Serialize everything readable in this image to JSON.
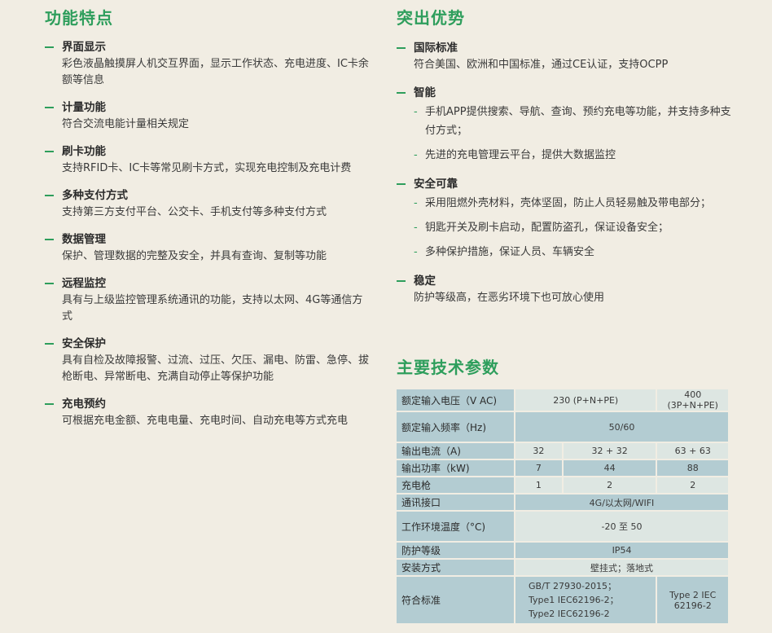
{
  "features": {
    "title": "功能特点",
    "items": [
      {
        "title": "界面显示",
        "desc": "彩色液晶触摸屏人机交互界面，显示工作状态、充电进度、IC卡余额等信息"
      },
      {
        "title": "计量功能",
        "desc": "符合交流电能计量相关规定"
      },
      {
        "title": "刷卡功能",
        "desc": "支持RFID卡、IC卡等常见刷卡方式，实现充电控制及充电计费"
      },
      {
        "title": "多种支付方式",
        "desc": "支持第三方支付平台、公交卡、手机支付等多种支付方式"
      },
      {
        "title": "数据管理",
        "desc": "保护、管理数据的完整及安全，并具有查询、复制等功能"
      },
      {
        "title": "远程监控",
        "desc": "具有与上级监控管理系统通讯的功能，支持以太网、4G等通信方式"
      },
      {
        "title": "安全保护",
        "desc": "具有自检及故障报警、过流、过压、欠压、漏电、防雷、急停、拔枪断电、异常断电、充满自动停止等保护功能"
      },
      {
        "title": "充电预约",
        "desc": "可根据充电金额、充电电量、充电时间、自动充电等方式充电"
      }
    ]
  },
  "advantages": {
    "title": "突出优势",
    "items": [
      {
        "title": "国际标准",
        "desc": "符合美国、欧洲和中国标准，通过CE认证，支持OCPP"
      },
      {
        "title": "智能",
        "subs": [
          "手机APP提供搜索、导航、查询、预约充电等功能，并支持多种支付方式；",
          "先进的充电管理云平台，提供大数据监控"
        ]
      },
      {
        "title": "安全可靠",
        "subs": [
          "采用阻燃外壳材料，壳体坚固，防止人员轻易触及带电部分；",
          "钥匙开关及刷卡启动，配置防盗孔，保证设备安全；",
          "多种保护措施，保证人员、车辆安全"
        ]
      },
      {
        "title": "稳定",
        "desc": "防护等级高，在恶劣环境下也可放心使用"
      }
    ]
  },
  "specs": {
    "title": "主要技术参数",
    "rows": {
      "voltage": {
        "label": "额定输入电压（V AC)",
        "v1": "230 (P+N+PE)",
        "v2": "400 (3P+N+PE)"
      },
      "freq": {
        "label": "额定输入频率（Hz)",
        "v": "50/60"
      },
      "current": {
        "label": "输出电流（A)",
        "v1": "32",
        "v2": "32 + 32",
        "v3": "63 + 63"
      },
      "power": {
        "label": "输出功率（kW)",
        "v1": "7",
        "v2": "44",
        "v3": "88"
      },
      "gun": {
        "label": "充电枪",
        "v1": "1",
        "v2": "2",
        "v3": "2"
      },
      "comm": {
        "label": "通讯接口",
        "v": "4G/以太网/WIFI"
      },
      "temp": {
        "label": "工作环境温度（°C)",
        "v": "-20 至 50"
      },
      "ip": {
        "label": "防护等级",
        "v": "IP54"
      },
      "install": {
        "label": "安装方式",
        "v": "壁挂式；落地式"
      },
      "standard": {
        "label": "符合标准",
        "v1a": "GB/T 27930-2015；",
        "v1b": "Type1 IEC62196-2；",
        "v1c": "Type2 IEC62196-2",
        "v2": "Type 2 IEC 62196-2"
      }
    }
  }
}
